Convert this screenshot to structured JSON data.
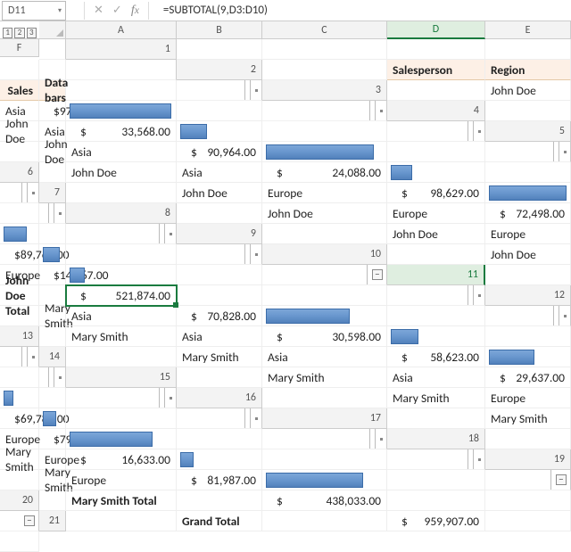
{
  "namebox": "D11",
  "formula": "=SUBTOTAL(9,D3:D10)",
  "outline_levels": [
    "1",
    "2",
    "3"
  ],
  "columns": [
    "A",
    "B",
    "C",
    "D",
    "E",
    "F"
  ],
  "headers": {
    "salesperson": "Salesperson",
    "region": "Region",
    "sales": "Sales",
    "databars": "Data bars"
  },
  "currency": "$",
  "max_bar": 98629,
  "rows": [
    {
      "n": 3,
      "p": "John Doe",
      "r": "Asia",
      "v": 97496,
      "f": "97,496.00"
    },
    {
      "n": 4,
      "p": "John Doe",
      "r": "Asia",
      "v": 33568,
      "f": "33,568.00"
    },
    {
      "n": 5,
      "p": "John Doe",
      "r": "Asia",
      "v": 90964,
      "f": "90,964.00"
    },
    {
      "n": 6,
      "p": "John Doe",
      "r": "Asia",
      "v": 24088,
      "f": "24,088.00"
    },
    {
      "n": 7,
      "p": "John Doe",
      "r": "Europe",
      "v": 98629,
      "f": "98,629.00"
    },
    {
      "n": 8,
      "p": "John Doe",
      "r": "Europe",
      "v": 72498,
      "f": "72,498.00"
    },
    {
      "n": 9,
      "p": "John Doe",
      "r": "Europe",
      "v": 89764,
      "f": "89,764.00"
    },
    {
      "n": 10,
      "p": "John Doe",
      "r": "Europe",
      "v": 14867,
      "f": "14,867.00"
    }
  ],
  "subtotal1": {
    "n": 11,
    "label": "John Doe Total",
    "f": "521,874.00"
  },
  "rows2": [
    {
      "n": 12,
      "p": "Mary Smith",
      "r": "Asia",
      "v": 70828,
      "f": "70,828.00"
    },
    {
      "n": 13,
      "p": "Mary Smith",
      "r": "Asia",
      "v": 30598,
      "f": "30,598.00"
    },
    {
      "n": 14,
      "p": "Mary Smith",
      "r": "Asia",
      "v": 58623,
      "f": "58,623.00"
    },
    {
      "n": 15,
      "p": "Mary Smith",
      "r": "Asia",
      "v": 29637,
      "f": "29,637.00"
    },
    {
      "n": 16,
      "p": "Mary Smith",
      "r": "Europe",
      "v": 69788,
      "f": "69,788.00"
    },
    {
      "n": 17,
      "p": "Mary Smith",
      "r": "Europe",
      "v": 79939,
      "f": "79,939.00"
    },
    {
      "n": 18,
      "p": "Mary Smith",
      "r": "Europe",
      "v": 16633,
      "f": "16,633.00"
    },
    {
      "n": 19,
      "p": "Mary Smith",
      "r": "Europe",
      "v": 81987,
      "f": "81,987.00"
    }
  ],
  "subtotal2": {
    "n": 20,
    "label": "Mary Smith Total",
    "f": "438,033.00"
  },
  "grandtotal": {
    "n": 21,
    "label": "Grand Total",
    "f": "959,907.00"
  },
  "chart_data": {
    "type": "bar",
    "title": "Data bars",
    "xlabel": "",
    "ylabel": "",
    "ylim": [
      0,
      98629
    ],
    "series": [
      {
        "name": "John Doe / Asia",
        "values": [
          97496,
          33568,
          90964,
          24088
        ]
      },
      {
        "name": "John Doe / Europe",
        "values": [
          98629,
          72498,
          89764,
          14867
        ]
      },
      {
        "name": "Mary Smith / Asia",
        "values": [
          70828,
          30598,
          58623,
          29637
        ]
      },
      {
        "name": "Mary Smith / Europe",
        "values": [
          69788,
          79939,
          16633,
          81987
        ]
      }
    ]
  }
}
